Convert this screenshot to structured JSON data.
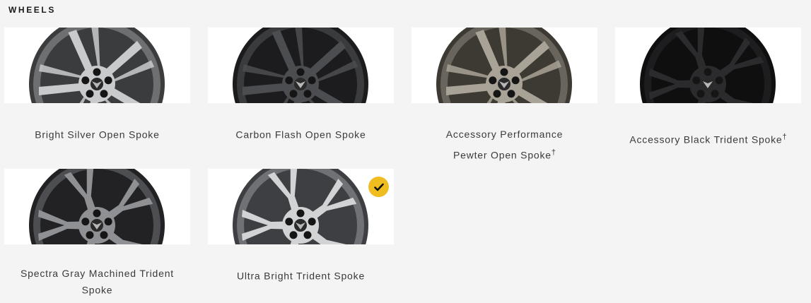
{
  "section": {
    "title": "WHEELS"
  },
  "wheels": [
    {
      "name": "Bright Silver Open Spoke",
      "dagger": "",
      "selected": false,
      "style": "open",
      "rim": "#6e6f71",
      "spoke": "#c9cacc",
      "dark": "#3b3c3e"
    },
    {
      "name": "Carbon Flash Open Spoke",
      "dagger": "",
      "selected": false,
      "style": "open",
      "rim": "#3a3b3d",
      "spoke": "#4c4d50",
      "dark": "#1c1c1e"
    },
    {
      "name": "Accessory Performance Pewter Open Spoke",
      "dagger": "†",
      "selected": false,
      "style": "open",
      "rim": "#6a655c",
      "spoke": "#a9a397",
      "dark": "#3d3a34"
    },
    {
      "name": "Accessory Black Trident Spoke",
      "dagger": "†",
      "selected": false,
      "style": "trident",
      "rim": "#1d1d1f",
      "spoke": "#2b2b2d",
      "dark": "#0f0f10"
    },
    {
      "name": "Spectra Gray Machined Trident Spoke",
      "dagger": "",
      "selected": false,
      "style": "trident",
      "rim": "#4d4e51",
      "spoke": "#8f9094",
      "dark": "#222224"
    },
    {
      "name": "Ultra Bright Trident Spoke",
      "dagger": "",
      "selected": true,
      "style": "trident",
      "rim": "#707174",
      "spoke": "#d2d3d5",
      "dark": "#3e3f42"
    }
  ],
  "colors": {
    "accent": "#f0bd20",
    "background": "#f4f4f4"
  }
}
